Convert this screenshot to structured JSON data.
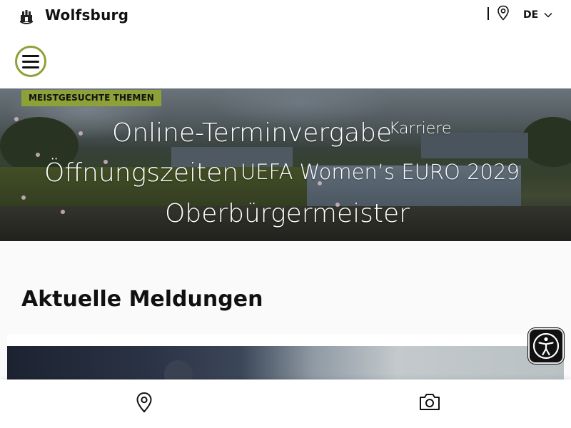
{
  "header": {
    "brand": "Wolfsburg",
    "language": "DE",
    "icons": [
      "crest-logo-icon",
      "location-pin-icon",
      "chevron-down-icon"
    ]
  },
  "menu": {
    "icon": "hamburger-menu-icon"
  },
  "hero": {
    "badge": "MEISTGESUCHTE THEMEN",
    "topics": [
      "Online-Terminvergabe",
      "Karriere",
      "Öffnungszeiten",
      "UEFA Women’s EURO 2029",
      "Oberbürgermeister"
    ]
  },
  "news": {
    "title": "Aktuelle Meldungen"
  },
  "accessibility": {
    "icon": "accessibility-person-icon"
  },
  "bottom_nav": {
    "icons": [
      "location-pin-icon",
      "camera-icon"
    ]
  },
  "colors": {
    "accent": "#8ea138",
    "text": "#111111",
    "background": "#fafafa"
  }
}
